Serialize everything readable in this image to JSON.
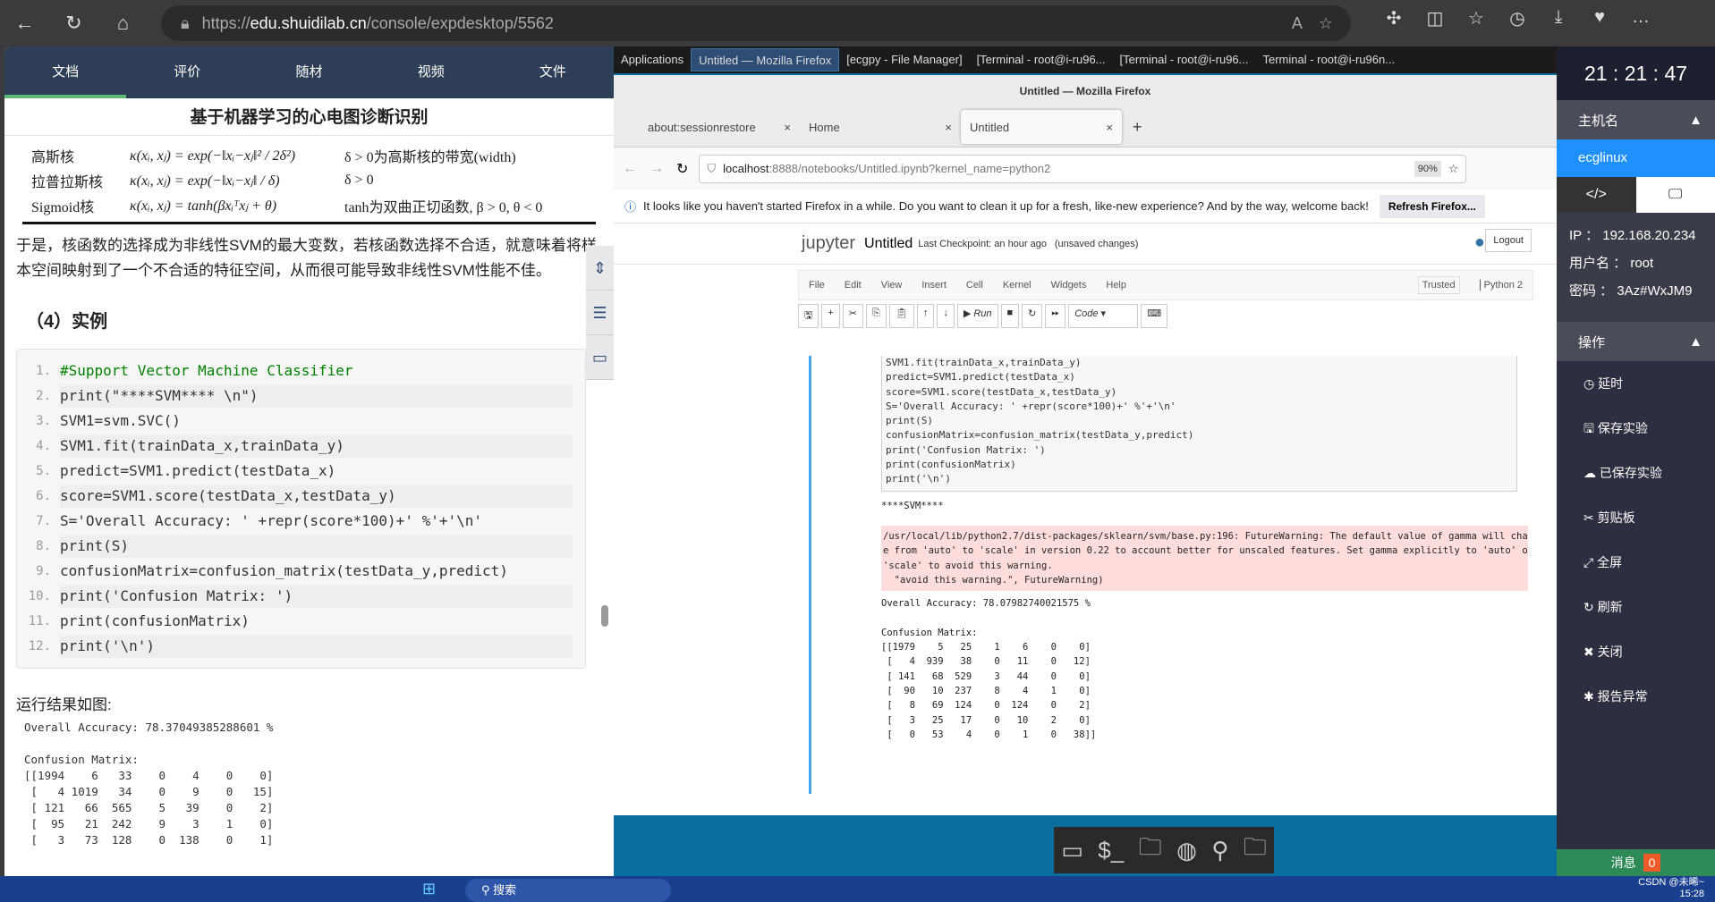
{
  "browser": {
    "url_scheme": "https://",
    "url_host": "edu.shuidilab.cn",
    "url_path": "/console/expdesktop/5562",
    "icons": [
      "back-icon",
      "refresh-icon",
      "home-icon",
      "lock-icon",
      "read-aloud-icon",
      "favorite-icon",
      "extensions-icon",
      "split-screen-icon",
      "favorites-icon",
      "history-icon",
      "download-icon",
      "health-icon",
      "more-icon"
    ]
  },
  "doc": {
    "tabs": [
      "文档",
      "评价",
      "随材",
      "视频",
      "文件"
    ],
    "title": "基于机器学习的心电图诊断识别",
    "kernels": [
      {
        "name": "高斯核",
        "formula": "κ(xᵢ, xⱼ) = exp(−‖xᵢ−xⱼ‖² / 2δ²)",
        "note": "δ > 0为高斯核的带宽(width)"
      },
      {
        "name": "拉普拉斯核",
        "formula": "κ(xᵢ, xⱼ) = exp(−‖xᵢ−xⱼ‖ / δ)",
        "note": "δ > 0"
      },
      {
        "name": "Sigmoid核",
        "formula": "κ(xᵢ, xⱼ) = tanh(βxᵢᵀxⱼ + θ)",
        "note": "tanh为双曲正切函数, β > 0, θ < 0"
      }
    ],
    "paragraph": "于是，核函数的选择成为非线性SVM的最大变数，若核函数选择不合适，就意味着将样本空间映射到了一个不合适的特征空间，从而很可能导致非线性SVM性能不佳。",
    "section": "（4）实例",
    "code": [
      {
        "n": "1.",
        "t": "#Support Vector Machine Classifier"
      },
      {
        "n": "2.",
        "t": "print(\"****SVM**** \\n\")"
      },
      {
        "n": "3.",
        "t": "SVM1=svm.SVC()"
      },
      {
        "n": "4.",
        "t": "SVM1.fit(trainData_x,trainData_y)"
      },
      {
        "n": "5.",
        "t": "predict=SVM1.predict(testData_x)"
      },
      {
        "n": "6.",
        "t": "score=SVM1.score(testData_x,testData_y)"
      },
      {
        "n": "7.",
        "t": "S='Overall Accuracy: ' +repr(score*100)+' %'+'\\n'"
      },
      {
        "n": "8.",
        "t": "print(S)"
      },
      {
        "n": "9.",
        "t": "confusionMatrix=confusion_matrix(testData_y,predict)"
      },
      {
        "n": "10.",
        "t": "print('Confusion Matrix: ')"
      },
      {
        "n": "11.",
        "t": "print(confusionMatrix)"
      },
      {
        "n": "12.",
        "t": "print('\\n')"
      }
    ],
    "result_heading": "运行结果如图:",
    "result_output": "Overall Accuracy: 78.37049385288601 %\n\nConfusion Matrix:\n[[1994    6   33    0    4    0    0]\n [   4 1019   34    0    9    0   15]\n [ 121   66  565    5   39    0    2]\n [  95   21  242    9    3    1    0]\n [   3   73  128    0  138    0    1]"
  },
  "remote": {
    "taskbar": [
      "Applications",
      "Untitled — Mozilla Firefox",
      "[ecgpy - File Manager]",
      "[Terminal - root@i-ru96...",
      "[Terminal - root@i-ru96...",
      "Terminal - root@i-ru96n..."
    ],
    "window_title": "Untitled — Mozilla Firefox",
    "tabs": [
      "about:sessionrestore",
      "Home",
      "Untitled"
    ],
    "url_host": "localhost",
    "url_rest": ":8888/notebooks/Untitled.ipynb?kernel_name=python2",
    "zoom": "90%",
    "notice": "It looks like you haven't started Firefox in a while. Do you want to clean it up for a fresh, like-new experience? And by the way, welcome back!",
    "refresh_btn": "Refresh Firefox...",
    "jupyter": {
      "logo": "jupyter",
      "name": "Untitled",
      "checkpoint": "Last Checkpoint: an hour ago",
      "unsaved": "(unsaved changes)",
      "logout": "Logout",
      "menu": [
        "File",
        "Edit",
        "View",
        "Insert",
        "Cell",
        "Kernel",
        "Widgets",
        "Help"
      ],
      "trusted": "Trusted",
      "kernel": "Python 2",
      "run": "Run",
      "cell_type": "Code",
      "code": "SVM1.fit(trainData_x,trainData_y)\npredict=SVM1.predict(testData_x)\nscore=SVM1.score(testData_x,testData_y)\nS='Overall Accuracy: ' +repr(score*100)+' %'+'\\n'\nprint(S)\nconfusionMatrix=confusion_matrix(testData_y,predict)\nprint('Confusion Matrix: ')\nprint(confusionMatrix)\nprint('\\n')",
      "out_header": "****SVM****",
      "warning": "/usr/local/lib/python2.7/dist-packages/sklearn/svm/base.py:196: FutureWarning: The default value of gamma will chang\ne from 'auto' to 'scale' in version 0.22 to account better for unscaled features. Set gamma explicitly to 'auto' or\n'scale' to avoid this warning.\n  \"avoid this warning.\", FutureWarning)",
      "output": "Overall Accuracy: 78.07982740021575 %\n\nConfusion Matrix:\n[[1979    5   25    1    6    0    0]\n [   4  939   38    0   11    0   12]\n [ 141   68  529    3   44    0    0]\n [  90   10  237    8    4    1    0]\n [   8   69  124    0  124    0    2]\n [   3   25   17    0   10    2    0]\n [   0   53    4    0    1    0   38]]"
    }
  },
  "panel": {
    "clock": "21 : 21 : 47",
    "host_label": "主机名",
    "host": "ecglinux",
    "ip": "IP ： 192.168.20.234",
    "user": "用户名 ： root",
    "pwd": "密码 ： 3Az#WxJM9",
    "ops_label": "操作",
    "ops": [
      "延时",
      "保存实验",
      "已保存实验",
      "剪贴板",
      "全屏",
      "刷新",
      "关闭",
      "报告异常"
    ],
    "msg": "消息",
    "msg_count": "0"
  },
  "taskbar": {
    "search": "搜索",
    "watermark": "CSDN @未晞~",
    "time": "15:28"
  }
}
